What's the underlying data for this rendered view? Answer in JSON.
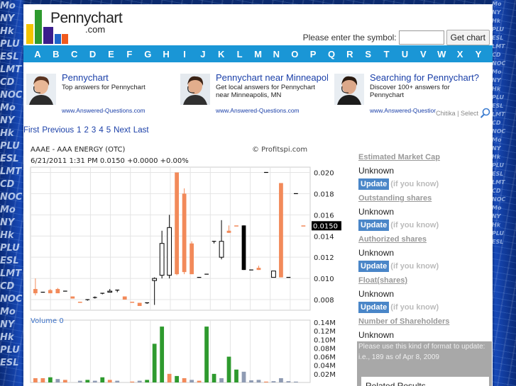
{
  "site": {
    "logo_text": "Pennychart",
    "logo_sub": ".com",
    "symbol_label": "Please enter the symbol:",
    "symbol_value": "",
    "symbol_button": "Get chart"
  },
  "alphabet": [
    "A",
    "B",
    "C",
    "D",
    "E",
    "F",
    "G",
    "H",
    "I",
    "J",
    "K",
    "L",
    "M",
    "N",
    "O",
    "P",
    "Q",
    "R",
    "S",
    "T",
    "U",
    "V",
    "W",
    "X",
    "Y"
  ],
  "ads": [
    {
      "title": "Pennychart",
      "desc": "Top answers for Pennychart",
      "url": "www.Answered-Questions.com"
    },
    {
      "title": "Pennychart near Minneapolis",
      "desc": "Get local answers for Pennychart near Minneapolis, MN",
      "url": "www.Answered-Questions.com"
    },
    {
      "title": "Searching for Pennychart?",
      "desc": "Discover 100+ answers for Pennychart",
      "url": "www.Answered-Questions.com"
    }
  ],
  "ad_choice": "Chitika | Select",
  "pager": {
    "first": "First",
    "previous": "Previous",
    "pages": [
      "1",
      "2",
      "3",
      "4",
      "5"
    ],
    "next": "Next",
    "last": "Last"
  },
  "chart": {
    "symbol_line": "AAAE - AAA ENERGY (OTC)",
    "brand": "© Profitspi.com",
    "quote_line": "6/21/2011 1:31 PM  0.0150 +0.0000 +0.00%",
    "volume_label": "Volume  0",
    "current_price": "0.0150"
  },
  "chart_data": {
    "type": "candlestick",
    "price_axis": {
      "ticks": [
        "0.020",
        "0.018",
        "0.016",
        "0.014",
        "0.012",
        "0.010",
        "0.008"
      ],
      "current": "0.0150"
    },
    "volume_axis": {
      "ticks": [
        "0.14M",
        "0.12M",
        "0.10M",
        "0.08M",
        "0.06M",
        "0.04M",
        "0.02M"
      ]
    },
    "grid": true,
    "colors": {
      "down": "#f28a5a",
      "up_outline": "#000000",
      "volume_up": "#2e9a2e",
      "volume_neutral": "#8f9bb3",
      "volume_down": "#f28a5a"
    },
    "candles": [
      {
        "open": 0.009,
        "close": 0.0086,
        "high": 0.01,
        "low": 0.0084,
        "color": "down"
      },
      {
        "open": 0.0087,
        "close": 0.0087,
        "high": 0.0087,
        "low": 0.0087,
        "color": "flat"
      },
      {
        "open": 0.0086,
        "close": 0.0089,
        "high": 0.009,
        "low": 0.0086,
        "color": "down"
      },
      {
        "open": 0.009,
        "close": 0.0086,
        "high": 0.0091,
        "low": 0.0086,
        "color": "down"
      },
      {
        "open": 0.0088,
        "close": 0.0088,
        "high": 0.0088,
        "low": 0.0088,
        "color": "flat"
      },
      {
        "open": 0.0083,
        "close": 0.0081,
        "high": 0.0083,
        "low": 0.0081,
        "color": "down"
      },
      {
        "open": 0.0077,
        "close": 0.0078,
        "high": 0.0078,
        "low": 0.0077,
        "color": "down"
      },
      {
        "open": 0.0079,
        "close": 0.008,
        "high": 0.008,
        "low": 0.0079,
        "color": "flat"
      },
      {
        "open": 0.0081,
        "close": 0.0082,
        "high": 0.0083,
        "low": 0.0081,
        "color": "flat"
      },
      {
        "open": 0.0085,
        "close": 0.0086,
        "high": 0.0086,
        "low": 0.0085,
        "color": "flat"
      },
      {
        "open": 0.0088,
        "close": 0.0087,
        "high": 0.009,
        "low": 0.0087,
        "color": "up"
      },
      {
        "open": 0.0089,
        "close": 0.0088,
        "high": 0.0089,
        "low": 0.0087,
        "color": "flat"
      },
      {
        "open": 0.0083,
        "close": 0.008,
        "high": 0.0083,
        "low": 0.008,
        "color": "down"
      },
      {
        "open": 0.0078,
        "close": 0.0077,
        "high": 0.0078,
        "low": 0.0077,
        "color": "down"
      },
      {
        "open": 0.0077,
        "close": 0.0074,
        "high": 0.0077,
        "low": 0.0074,
        "color": "down"
      },
      {
        "open": 0.0076,
        "close": 0.0077,
        "high": 0.0077,
        "low": 0.0076,
        "color": "flat"
      },
      {
        "open": 0.0098,
        "close": 0.01,
        "high": 0.0101,
        "low": 0.0075,
        "color": "up"
      },
      {
        "open": 0.0103,
        "close": 0.0133,
        "high": 0.0145,
        "low": 0.01,
        "color": "up"
      },
      {
        "open": 0.0148,
        "close": 0.0103,
        "high": 0.016,
        "low": 0.01,
        "color": "up"
      },
      {
        "open": 0.02,
        "close": 0.0104,
        "high": 0.02,
        "low": 0.0103,
        "color": "down"
      },
      {
        "open": 0.018,
        "close": 0.0106,
        "high": 0.0185,
        "low": 0.0104,
        "color": "down"
      },
      {
        "open": 0.0133,
        "close": 0.0104,
        "high": 0.0135,
        "low": 0.0104,
        "color": "down"
      },
      {
        "open": 0.0101,
        "close": 0.0101,
        "high": 0.0101,
        "low": 0.0101,
        "color": "flat"
      },
      {
        "open": 0.0104,
        "close": 0.0104,
        "high": 0.0104,
        "low": 0.0104,
        "color": "flat"
      },
      {
        "open": 0.0135,
        "close": 0.0133,
        "high": 0.0135,
        "low": 0.0133,
        "color": "flat"
      },
      {
        "open": 0.0135,
        "close": 0.012,
        "high": 0.0155,
        "low": 0.0118,
        "color": "up"
      },
      {
        "open": 0.0145,
        "close": 0.0143,
        "high": 0.015,
        "low": 0.0143,
        "color": "down"
      },
      {
        "open": 0.015,
        "close": 0.015,
        "high": 0.015,
        "low": 0.015,
        "color": "down"
      },
      {
        "open": 0.015,
        "close": 0.0108,
        "high": 0.015,
        "low": 0.0108,
        "color": "black"
      },
      {
        "open": 0.0108,
        "close": 0.0108,
        "high": 0.0108,
        "low": 0.0108,
        "color": "flat"
      },
      {
        "open": 0.011,
        "close": 0.0108,
        "high": 0.0112,
        "low": 0.0108,
        "color": "down"
      },
      {
        "open": 0.02,
        "close": 0.02,
        "high": 0.02,
        "low": 0.02,
        "color": "flat"
      },
      {
        "open": 0.0107,
        "close": 0.0101,
        "high": 0.0107,
        "low": 0.0101,
        "color": "up"
      },
      {
        "open": 0.019,
        "close": 0.0101,
        "high": 0.019,
        "low": 0.0101,
        "color": "down"
      },
      {
        "open": 0.0101,
        "close": 0.0101,
        "high": 0.0101,
        "low": 0.0101,
        "color": "flat"
      },
      {
        "open": 0.018,
        "close": 0.018,
        "high": 0.018,
        "low": 0.018,
        "color": "flat"
      },
      {
        "open": 0.015,
        "close": 0.015,
        "high": 0.015,
        "low": 0.015,
        "color": "down"
      }
    ],
    "volumes": [
      {
        "v": 0.01,
        "c": "down"
      },
      {
        "v": 0.01,
        "c": "down"
      },
      {
        "v": 0.012,
        "c": "up"
      },
      {
        "v": 0.008,
        "c": "neutral"
      },
      {
        "v": 0.006,
        "c": "down"
      },
      {
        "v": 0.0,
        "c": "flat"
      },
      {
        "v": 0.004,
        "c": "neutral"
      },
      {
        "v": 0.006,
        "c": "up"
      },
      {
        "v": 0.004,
        "c": "neutral"
      },
      {
        "v": 0.012,
        "c": "up"
      },
      {
        "v": 0.006,
        "c": "down"
      },
      {
        "v": 0.004,
        "c": "neutral"
      },
      {
        "v": 0.0,
        "c": "flat"
      },
      {
        "v": 0.002,
        "c": "down"
      },
      {
        "v": 0.004,
        "c": "neutral"
      },
      {
        "v": 0.006,
        "c": "up"
      },
      {
        "v": 0.09,
        "c": "up"
      },
      {
        "v": 0.13,
        "c": "up"
      },
      {
        "v": 0.02,
        "c": "down"
      },
      {
        "v": 0.015,
        "c": "up"
      },
      {
        "v": 0.01,
        "c": "down"
      },
      {
        "v": 0.006,
        "c": "neutral"
      },
      {
        "v": 0.004,
        "c": "down"
      },
      {
        "v": 0.13,
        "c": "up"
      },
      {
        "v": 0.02,
        "c": "up"
      },
      {
        "v": 0.01,
        "c": "neutral"
      },
      {
        "v": 0.06,
        "c": "up"
      },
      {
        "v": 0.03,
        "c": "up"
      },
      {
        "v": 0.025,
        "c": "neutral"
      },
      {
        "v": 0.005,
        "c": "neutral"
      },
      {
        "v": 0.006,
        "c": "neutral"
      },
      {
        "v": 0.002,
        "c": "down"
      },
      {
        "v": 0.003,
        "c": "neutral"
      },
      {
        "v": 0.01,
        "c": "neutral"
      },
      {
        "v": 0.003,
        "c": "neutral"
      },
      {
        "v": 0.002,
        "c": "neutral"
      },
      {
        "v": 0.0,
        "c": "flat"
      }
    ]
  },
  "right_panel": {
    "fields": [
      {
        "label": "Estimated Market Cap",
        "value": "Unknown"
      },
      {
        "label": "Outstanding shares",
        "value": "Unknown"
      },
      {
        "label": "Authorized shares",
        "value": "Unknown"
      },
      {
        "label": "Float(shares)",
        "value": "Unknown"
      },
      {
        "label": "Number of Shareholders",
        "value": "Unknown"
      }
    ],
    "update_button": "Update",
    "update_hint": "(if you know)",
    "note": "Please use this kind of format to update: i.e., 189 as of Apr 8, 2009",
    "related": "Related Results"
  },
  "side_decor_text": [
    "Mo",
    "NY",
    "Hk",
    "PLU",
    "ESL",
    "LMT",
    "CD",
    "NOC",
    "Mo",
    "NY",
    "Hk",
    "PLU",
    "ESL",
    "LMT",
    "CD",
    "NOC",
    "Mo",
    "NY",
    "Hk",
    "PLU",
    "ESL",
    "LMT",
    "CD",
    "NOC",
    "Mo",
    "NY",
    "Hk",
    "PLU",
    "ESL"
  ]
}
